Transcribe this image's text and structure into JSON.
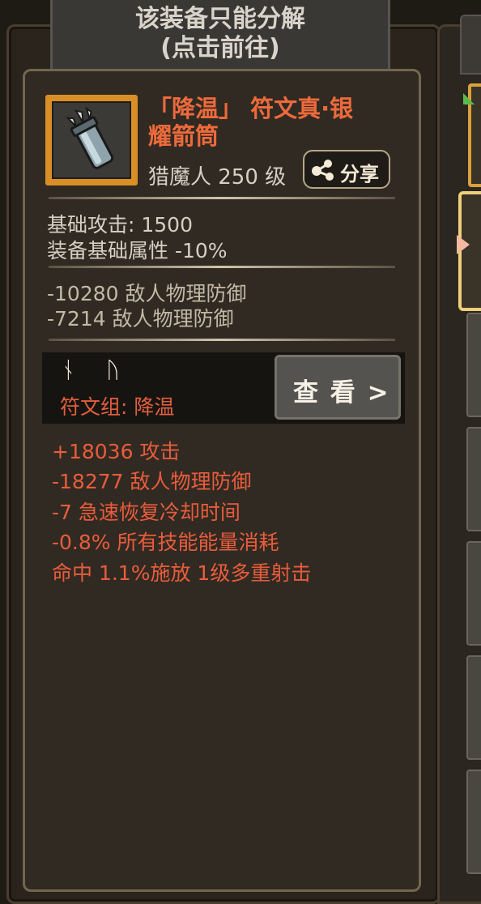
{
  "banner": {
    "line1": "该装备只能分解",
    "line2": "(点击前往)"
  },
  "item": {
    "name_line1": "「降温」 符文真·银",
    "name_line2": "耀箭筒",
    "class_level": "猎魔人 250 级",
    "icon": "quiver-icon"
  },
  "share": {
    "label": "分享",
    "icon": "share-icon"
  },
  "base_stats": [
    "基础攻击:  1500",
    "装备基础属性 -10%"
  ],
  "extra_stats": [
    "-10280 敌人物理防御",
    "-7214 敌人物理防御"
  ],
  "rune": {
    "glyphs": [
      "ᚾ",
      "ᚢ"
    ],
    "group_label": "符文组:  降温",
    "view_label": "查 看 >"
  },
  "rune_effects": [
    "+18036 攻击",
    "-18277 敌人物理防御",
    "-7 急速恢复冷却时间",
    "-0.8% 所有技能能量消耗",
    "命中 1.1%施放 1级多重射击"
  ],
  "colors": {
    "name_red": "#ee6a3c",
    "effect_red": "#ea5c3c",
    "icon_border_orange": "#d98f26",
    "selected_slot_gold": "#f0d07a"
  }
}
